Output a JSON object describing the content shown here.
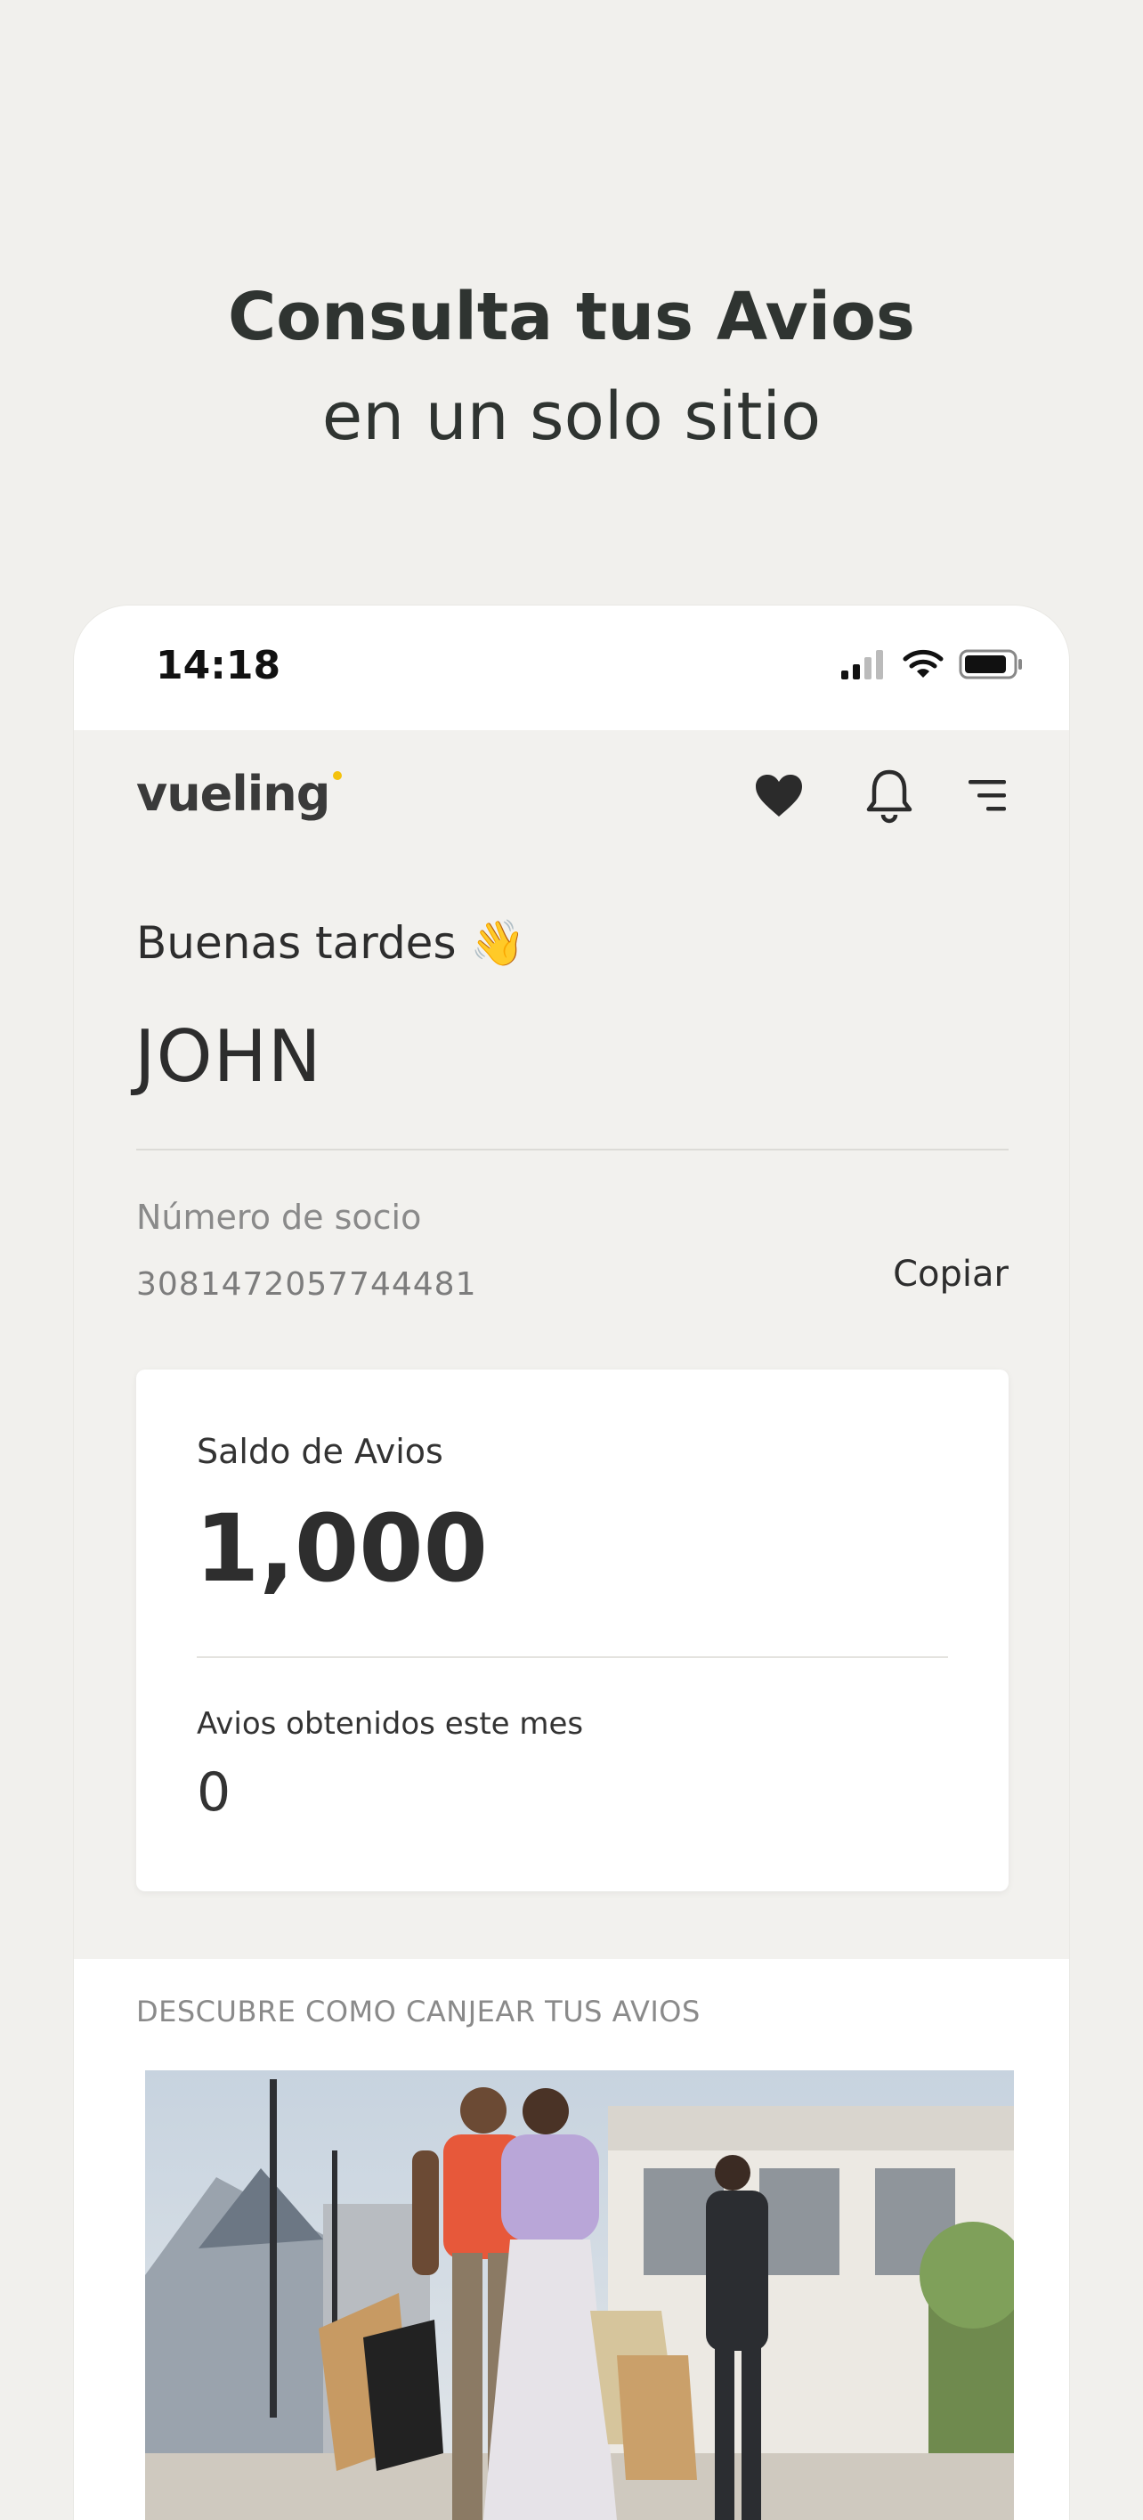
{
  "headline": {
    "line1": "Consulta tus Avios",
    "line2": "en un solo sitio"
  },
  "status_bar": {
    "time": "14:18",
    "icons": [
      "cellular-signal-icon",
      "wifi-icon",
      "battery-icon"
    ]
  },
  "app_bar": {
    "logo_text": "vueling",
    "logo_dot_color": "#f4c20d",
    "icons": [
      "heart-icon",
      "bell-icon",
      "menu-icon"
    ]
  },
  "greeting": "Buenas tardes 👋",
  "user_name": "JOHN",
  "member": {
    "label": "Número de socio",
    "number": "3081472057744481",
    "copy_label": "Copiar"
  },
  "avios_card": {
    "balance_label": "Saldo de Avios",
    "balance_value": "1,000",
    "month_label": "Avios obtenidos este mes",
    "month_value": "0"
  },
  "discover": {
    "title": "DESCUBRE COMO CANJEAR TUS AVIOS"
  },
  "colors": {
    "background": "#f1f0ed",
    "card": "#ffffff",
    "text": "#2b2b2b",
    "muted": "#8a8a8a"
  }
}
